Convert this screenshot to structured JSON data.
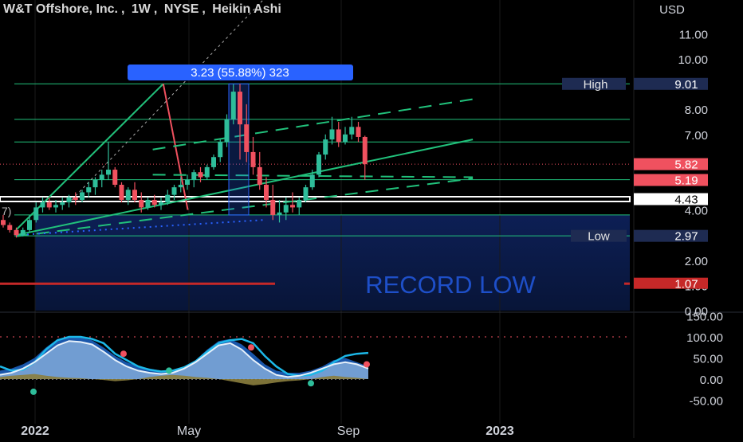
{
  "header": {
    "symbol": "W&T Offshore, Inc.",
    "interval": "1W",
    "exchange": "NYSE",
    "chart_style": "Heikin Ashi",
    "currency": "USD"
  },
  "annotations": {
    "measure_label": "3.23 (55.88%) 323",
    "record_low_label": "RECORD LOW",
    "high_label": "High",
    "low_label": "Low",
    "left_cut_label": "7)"
  },
  "colors": {
    "up": "#2ebd9a",
    "down": "#f0515f",
    "guide_line": "#21c17b",
    "measure_box": "#2962ff",
    "record_low_fill": "#0b1c4e",
    "record_low_line": "#c62828",
    "record_low_text": "#1e4fc8",
    "label_dark": "#1e2b52",
    "label_red": "#f0515f",
    "white_line": "#ffffff",
    "osc_blue": "#1f66c9",
    "osc_light": "#b9d7f2",
    "osc_olive": "#8b7e3e",
    "osc_cyan": "#1cb8e8"
  },
  "chart_data": [
    {
      "type": "candlestick",
      "title": "W&T Offshore, Inc., 1W, NYSE, Heikin Ashi",
      "ylabel": "USD",
      "ylim": [
        0,
        12.2
      ],
      "y_ticks": [
        "11.00",
        "10.00",
        "8.00",
        "7.00",
        "4.00",
        "2.00",
        "1.00",
        "0.00"
      ],
      "x_ticks": [
        "2022",
        "May",
        "Sep",
        "2023"
      ],
      "price_labels": [
        {
          "text": "9.01",
          "value": 9.01,
          "style": "dark"
        },
        {
          "text": "5.82",
          "value": 5.82,
          "style": "red"
        },
        {
          "text": "5.19",
          "value": 5.19,
          "style": "red"
        },
        {
          "text": "4.43",
          "value": 4.43,
          "style": "white"
        },
        {
          "text": "2.97",
          "value": 2.97,
          "style": "dark"
        },
        {
          "text": "1.07",
          "value": 1.07,
          "style": "red"
        }
      ],
      "horizontal_levels": [
        9.01,
        7.6,
        6.7,
        5.2,
        3.8,
        2.97
      ],
      "current_price": 5.82,
      "record_low": 1.07,
      "candles": [
        [
          3.6,
          3.8,
          3.3,
          3.4
        ],
        [
          3.4,
          3.5,
          3.1,
          3.2
        ],
        [
          3.2,
          3.3,
          2.9,
          3.0
        ],
        [
          3.0,
          3.3,
          2.95,
          3.2
        ],
        [
          3.2,
          3.8,
          3.1,
          3.6
        ],
        [
          3.6,
          4.3,
          3.5,
          4.1
        ],
        [
          4.1,
          4.5,
          3.9,
          4.3
        ],
        [
          4.3,
          4.5,
          4.0,
          4.1
        ],
        [
          4.1,
          4.4,
          3.9,
          4.2
        ],
        [
          4.2,
          4.5,
          4.0,
          4.3
        ],
        [
          4.3,
          4.6,
          4.1,
          4.5
        ],
        [
          4.5,
          4.7,
          4.2,
          4.4
        ],
        [
          4.4,
          4.8,
          4.3,
          4.7
        ],
        [
          4.7,
          5.1,
          4.5,
          4.9
        ],
        [
          4.9,
          5.3,
          4.6,
          5.2
        ],
        [
          5.2,
          5.6,
          4.9,
          5.4
        ],
        [
          5.4,
          6.7,
          5.2,
          5.6
        ],
        [
          5.6,
          5.7,
          4.9,
          5.0
        ],
        [
          5.0,
          5.1,
          4.3,
          4.4
        ],
        [
          4.4,
          4.9,
          4.2,
          4.8
        ],
        [
          4.8,
          5.1,
          4.3,
          4.4
        ],
        [
          4.4,
          4.7,
          3.9,
          4.1
        ],
        [
          4.1,
          4.5,
          4.0,
          4.4
        ],
        [
          4.4,
          4.6,
          4.1,
          4.2
        ],
        [
          4.2,
          4.5,
          4.0,
          4.3
        ],
        [
          4.3,
          4.8,
          4.2,
          4.6
        ],
        [
          4.6,
          5.0,
          4.4,
          4.9
        ],
        [
          4.9,
          5.3,
          4.7,
          5.0
        ],
        [
          5.0,
          5.4,
          4.8,
          5.2
        ],
        [
          5.2,
          5.6,
          4.9,
          5.5
        ],
        [
          5.5,
          5.7,
          5.1,
          5.3
        ],
        [
          5.3,
          5.8,
          5.2,
          5.7
        ],
        [
          5.7,
          6.2,
          5.6,
          6.1
        ],
        [
          6.1,
          6.8,
          5.9,
          6.7
        ],
        [
          6.7,
          7.8,
          6.5,
          7.6
        ],
        [
          7.6,
          9.0,
          7.4,
          8.7
        ],
        [
          8.7,
          9.01,
          6.0,
          7.4
        ],
        [
          7.4,
          8.2,
          5.9,
          6.3
        ],
        [
          6.3,
          6.9,
          5.4,
          5.7
        ],
        [
          5.7,
          6.3,
          4.8,
          5.0
        ],
        [
          5.0,
          5.3,
          4.1,
          4.4
        ],
        [
          4.4,
          5.0,
          3.6,
          3.8
        ],
        [
          3.8,
          4.4,
          3.5,
          3.9
        ],
        [
          3.9,
          4.5,
          3.6,
          4.2
        ],
        [
          4.2,
          4.7,
          3.9,
          4.1
        ],
        [
          4.1,
          4.5,
          3.8,
          4.4
        ],
        [
          4.4,
          5.0,
          4.3,
          4.9
        ],
        [
          4.9,
          5.6,
          4.8,
          5.4
        ],
        [
          5.4,
          6.3,
          5.3,
          6.2
        ],
        [
          6.2,
          7.0,
          6.0,
          6.8
        ],
        [
          6.8,
          7.7,
          6.6,
          7.2
        ],
        [
          7.2,
          7.5,
          6.5,
          6.7
        ],
        [
          6.7,
          7.3,
          6.6,
          7.0
        ],
        [
          7.0,
          7.7,
          6.8,
          7.3
        ],
        [
          7.3,
          7.5,
          6.7,
          6.9
        ],
        [
          6.9,
          6.95,
          5.2,
          5.82
        ]
      ],
      "trend_lines": [
        {
          "name": "rise",
          "points": [
            [
              "2021-12-27",
              3.2
            ],
            [
              "2022-06-13",
              9.01
            ]
          ],
          "style": "solid"
        },
        {
          "name": "drop",
          "points": [
            [
              "2022-06-13",
              9.01
            ],
            [
              "2022-07-11",
              4.0
            ]
          ],
          "style": "solid-red"
        },
        {
          "name": "upper-channel",
          "points": [
            [
              "2021-12-27",
              3.0
            ],
            [
              "2023-06-01",
              6.8
            ]
          ],
          "style": "solid"
        },
        {
          "name": "dashed-top",
          "points": [
            [
              "2022-06-01",
              6.4
            ],
            [
              "2023-06-01",
              8.4
            ]
          ],
          "style": "dashed"
        },
        {
          "name": "dashed-mid",
          "points": [
            [
              "2022-06-01",
              5.4
            ],
            [
              "2023-06-01",
              5.3
            ]
          ],
          "style": "dashed"
        },
        {
          "name": "dashed-low",
          "points": [
            [
              "2021-12-27",
              2.95
            ],
            [
              "2023-06-01",
              5.25
            ]
          ],
          "style": "dashed"
        }
      ]
    },
    {
      "type": "area",
      "title": "",
      "ylim": [
        -60,
        160
      ],
      "y_ticks": [
        "150.00",
        "100.00",
        "50.00",
        "0.00",
        "-50.00"
      ],
      "series": [
        {
          "name": "",
          "color": "osc_blue",
          "values": [
            20,
            25,
            35,
            50,
            75,
            95,
            100,
            98,
            92,
            75,
            55,
            40,
            30,
            25,
            20,
            22,
            30,
            45,
            70,
            90,
            95,
            82,
            60,
            35,
            20,
            15,
            15,
            20,
            30,
            45,
            50,
            40,
            30
          ]
        },
        {
          "name": "",
          "color": "osc_light",
          "values": [
            10,
            15,
            25,
            40,
            60,
            80,
            90,
            88,
            82,
            65,
            45,
            30,
            20,
            15,
            12,
            15,
            25,
            40,
            60,
            80,
            85,
            70,
            45,
            25,
            10,
            5,
            8,
            15,
            25,
            35,
            40,
            35,
            25
          ]
        },
        {
          "name": "",
          "color": "osc_cyan",
          "values": [
            30,
            20,
            22,
            40,
            70,
            92,
            100,
            100,
            95,
            85,
            60,
            45,
            30,
            22,
            18,
            20,
            28,
            42,
            65,
            85,
            92,
            95,
            85,
            55,
            30,
            12,
            8,
            10,
            20,
            40,
            55,
            60,
            62
          ]
        },
        {
          "name": "",
          "color": "osc_olive",
          "values": [
            5,
            8,
            10,
            12,
            8,
            5,
            3,
            2,
            0,
            -2,
            -5,
            -3,
            0,
            5,
            8,
            10,
            8,
            5,
            3,
            0,
            -5,
            -10,
            -15,
            -12,
            -8,
            -5,
            -3,
            0,
            5,
            8,
            5,
            3,
            0
          ]
        }
      ]
    }
  ]
}
